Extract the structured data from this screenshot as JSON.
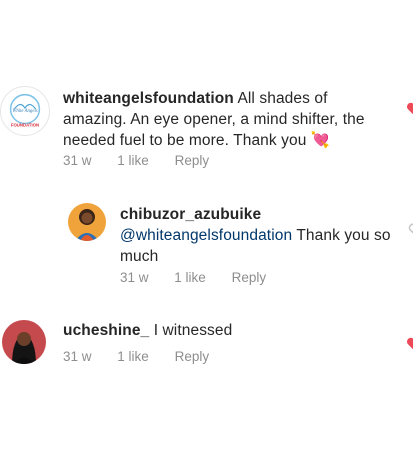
{
  "comments": [
    {
      "username": "whiteangelsfoundation",
      "text": "All shades of amazing. An eye opener, a mind shifter, the needed fuel to be more. Thank you",
      "emoji": "💘",
      "time": "31 w",
      "likes": "1 like",
      "reply_label": "Reply",
      "avatar_logo_lines": [
        "White Angels",
        "FOUNDATION"
      ]
    },
    {
      "username": "chibuzor_azubuike",
      "mention": "@whiteangelsfoundation",
      "text": "Thank you so much",
      "time": "31 w",
      "likes": "1 like",
      "reply_label": "Reply"
    },
    {
      "username": "ucheshine_",
      "text": "I witnessed",
      "time": "31 w",
      "likes": "1 like",
      "reply_label": "Reply"
    }
  ],
  "colors": {
    "text": "#262626",
    "meta": "#8e8e8e",
    "mention": "#00376b",
    "like_red": "#ed4956",
    "like_gray": "#c7c7c7"
  },
  "icons": [
    "heart-icon"
  ]
}
